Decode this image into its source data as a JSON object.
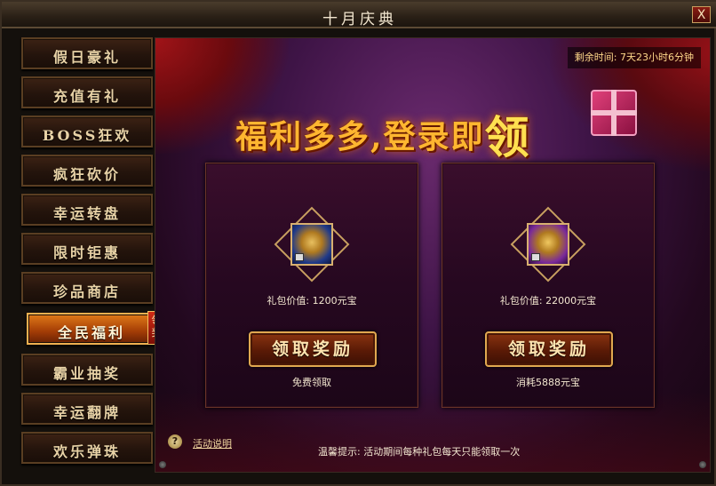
{
  "window": {
    "title": "十月庆典",
    "close_label": "X"
  },
  "sidebar": {
    "items": [
      {
        "label": "假日豪礼"
      },
      {
        "label": "充值有礼"
      },
      {
        "label": "BOSS狂欢"
      },
      {
        "label": "疯狂砍价"
      },
      {
        "label": "幸运转盘"
      },
      {
        "label": "限时钜惠"
      },
      {
        "label": "珍品商店"
      },
      {
        "label": "全民福利",
        "active": true,
        "badge": "领奖"
      },
      {
        "label": "霸业抽奖"
      },
      {
        "label": "幸运翻牌"
      },
      {
        "label": "欢乐弹珠"
      }
    ]
  },
  "main": {
    "remaining_time": "剩余时间: 7天23小时6分钟",
    "headline": "福利多多,登录即",
    "headline_emphasis": "领",
    "cards": [
      {
        "chest_icon": "blue-gold-treasure-chest-icon",
        "value_text": "礼包价值: 1200元宝",
        "button_label": "领取奖励",
        "cost_text": "免费领取"
      },
      {
        "chest_icon": "purple-gold-treasure-chest-icon",
        "value_text": "礼包价值: 22000元宝",
        "button_label": "领取奖励",
        "cost_text": "消耗5888元宝"
      }
    ],
    "help_icon_label": "?",
    "help_link": "活动说明",
    "tip": "温馨提示: 活动期间每种礼包每天只能领取一次"
  },
  "colors": {
    "accent_gold": "#ffb630",
    "active_tab": "#e07a18",
    "panel_purple": "#3e1446"
  }
}
